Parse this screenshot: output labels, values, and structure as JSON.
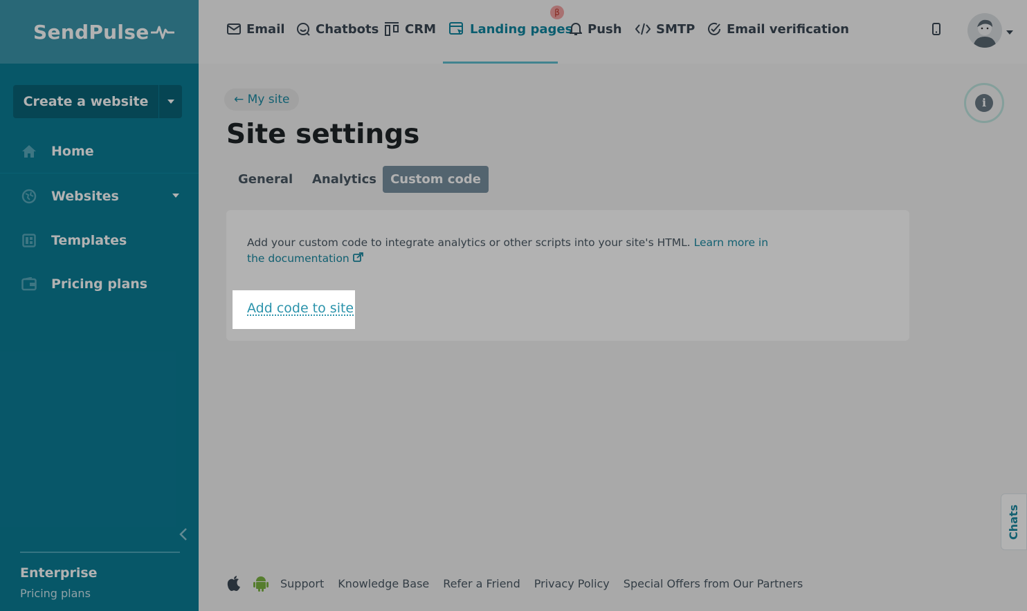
{
  "brand": {
    "logo_text": "SendPulse"
  },
  "sidebar": {
    "create_button": "Create a website",
    "items": [
      {
        "label": "Home"
      },
      {
        "label": "Websites"
      },
      {
        "label": "Templates"
      },
      {
        "label": "Pricing plans"
      }
    ],
    "plan_title": "Enterprise",
    "plan_link": "Pricing plans"
  },
  "topnav": {
    "items": [
      {
        "label": "Email"
      },
      {
        "label": "Chatbots"
      },
      {
        "label": "CRM"
      },
      {
        "label": "Landing pages"
      },
      {
        "label": "Push"
      },
      {
        "label": "SMTP"
      },
      {
        "label": "Email verification"
      }
    ],
    "beta_badge": "β",
    "active": "Landing pages"
  },
  "page": {
    "back_link": "← My site",
    "title": "Site settings",
    "tabs": [
      {
        "label": "General"
      },
      {
        "label": "Analytics"
      },
      {
        "label": "Custom code"
      }
    ],
    "active_tab": "Custom code",
    "info_glyph": "i"
  },
  "card": {
    "description": "Add your custom code to integrate analytics or other scripts into your site's HTML.",
    "doc_link": "Learn more in the documentation",
    "add_link": "Add code to site"
  },
  "footer": {
    "links": [
      "Support",
      "Knowledge Base",
      "Refer a Friend",
      "Privacy Policy",
      "Special Offers from Our Partners"
    ]
  },
  "chats_label": "Chats",
  "colors": {
    "sidebar": "#0b7d96",
    "accent": "#0f86a0",
    "active_tab": "#78909f"
  }
}
